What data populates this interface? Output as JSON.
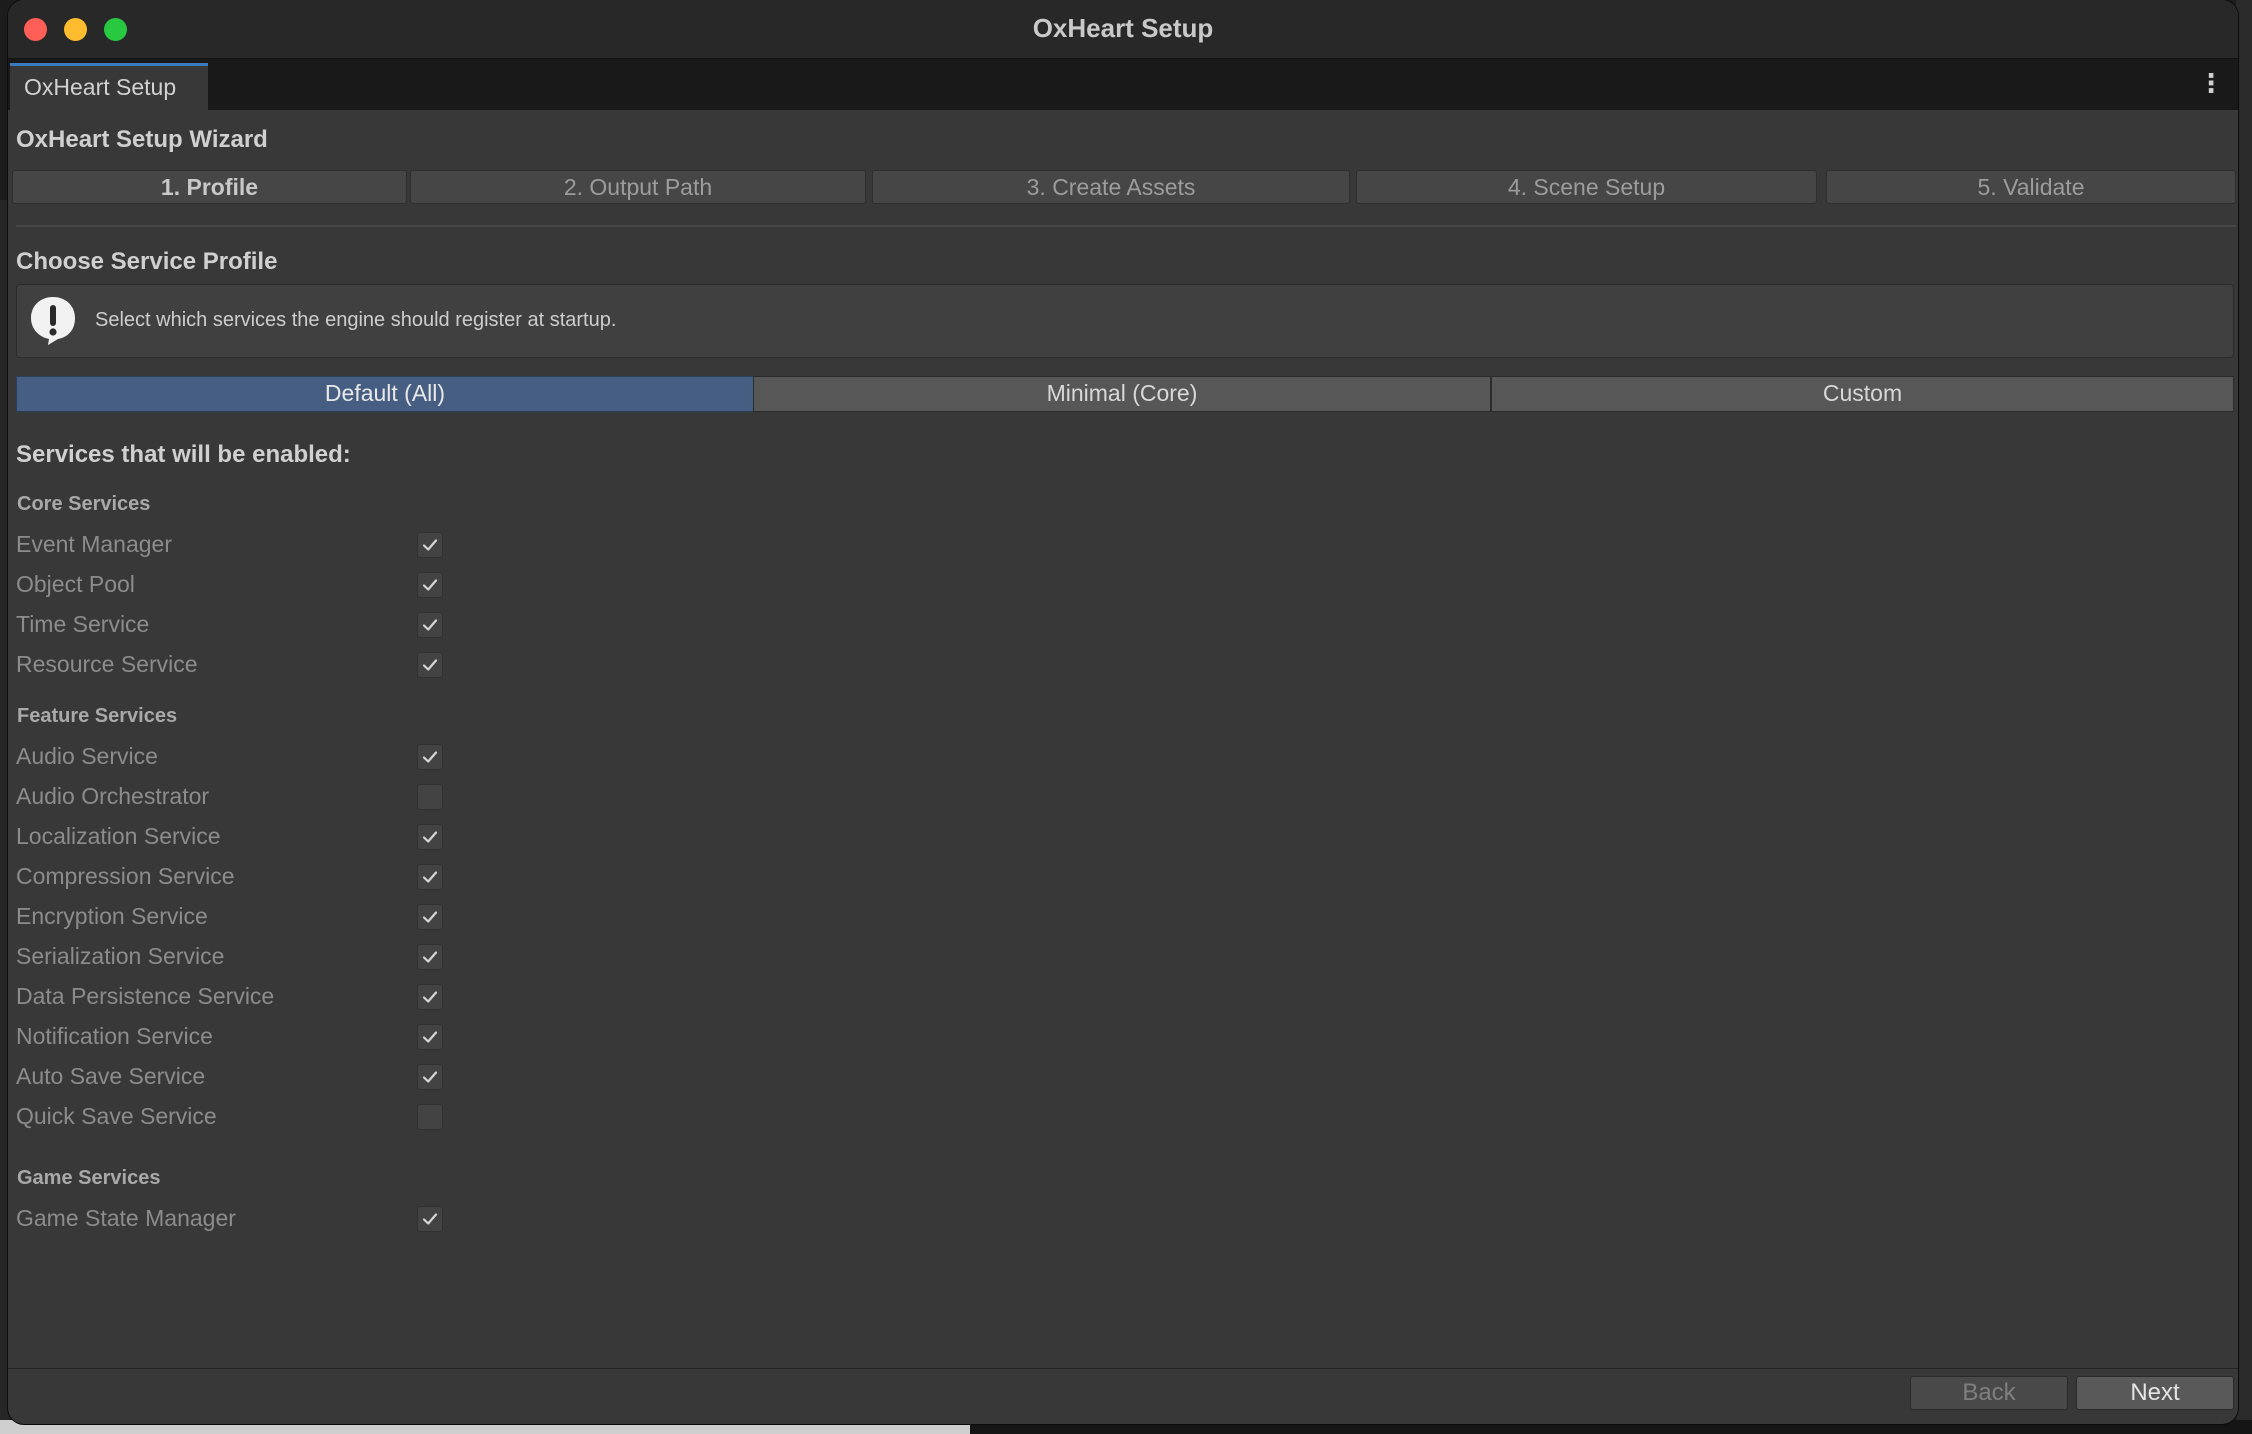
{
  "window": {
    "title": "OxHeart Setup"
  },
  "tab": {
    "label": "OxHeart Setup"
  },
  "wizard": {
    "title": "OxHeart Setup Wizard"
  },
  "steps": [
    {
      "label": "1. Profile",
      "active": true
    },
    {
      "label": "2. Output Path",
      "active": false
    },
    {
      "label": "3. Create Assets",
      "active": false
    },
    {
      "label": "4. Scene Setup",
      "active": false
    },
    {
      "label": "5. Validate",
      "active": false
    }
  ],
  "profile": {
    "title": "Choose Service Profile",
    "help_text": "Select which services the engine should register at startup.",
    "options": [
      "Default (All)",
      "Minimal (Core)",
      "Custom"
    ],
    "selected": "Default (All)"
  },
  "services": {
    "title": "Services that will be enabled:",
    "groups": [
      {
        "name": "Core Services",
        "items": [
          {
            "label": "Event Manager",
            "checked": true
          },
          {
            "label": "Object Pool",
            "checked": true
          },
          {
            "label": "Time Service",
            "checked": true
          },
          {
            "label": "Resource Service",
            "checked": true
          }
        ]
      },
      {
        "name": "Feature Services",
        "items": [
          {
            "label": "Audio Service",
            "checked": true
          },
          {
            "label": "Audio Orchestrator",
            "checked": false
          },
          {
            "label": "Localization Service",
            "checked": true
          },
          {
            "label": "Compression Service",
            "checked": true
          },
          {
            "label": "Encryption Service",
            "checked": true
          },
          {
            "label": "Serialization Service",
            "checked": true
          },
          {
            "label": "Data Persistence Service",
            "checked": true
          },
          {
            "label": "Notification Service",
            "checked": true
          },
          {
            "label": "Auto Save Service",
            "checked": true
          },
          {
            "label": "Quick Save Service",
            "checked": false
          }
        ]
      },
      {
        "name": "Game Services",
        "items": [
          {
            "label": "Game State Manager",
            "checked": true
          }
        ]
      }
    ]
  },
  "footer": {
    "back_label": "Back",
    "next_label": "Next"
  },
  "icons": {
    "help": "exclamation-bubble-icon",
    "menu": "kebab-menu-icon",
    "check": "checkmark-icon"
  },
  "colors": {
    "selected_profile": "#465e82",
    "tab_accent": "#3a79bb"
  }
}
